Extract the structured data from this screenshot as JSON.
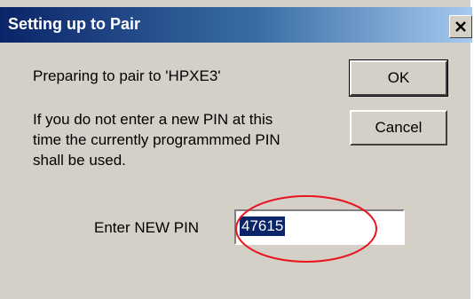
{
  "dialog": {
    "title": "Setting up to Pair",
    "close_label": "x",
    "message_prepare": "Preparing to pair to 'HPXE3'",
    "message_line1": "If you do not enter a new PIN at this",
    "message_line2": "time the currently programmmed PIN",
    "message_line3": "shall be used.",
    "ok_label": "OK",
    "cancel_label": "Cancel",
    "pin_label": "Enter NEW PIN",
    "pin_value": "47615"
  },
  "colors": {
    "title_bar_start": "#0a246a",
    "title_bar_end": "#a6caf0",
    "dialog_face": "#d4d0c8",
    "selection": "#0a246a",
    "annotation_ellipse": "#e8141e"
  },
  "icons": {
    "close": "close-x-icon"
  }
}
